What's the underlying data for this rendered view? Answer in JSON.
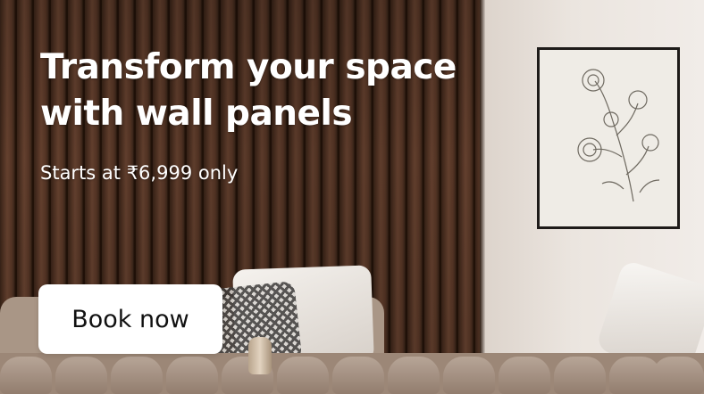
{
  "banner": {
    "headline": "Transform your space with wall panels",
    "subline": "Starts at ₹6,999 only",
    "cta_label": "Book now"
  },
  "colors": {
    "headline_text": "#ffffff",
    "cta_background": "#ffffff",
    "cta_text": "#111111",
    "wood": "#4d3021",
    "wall": "#ebe5df"
  }
}
